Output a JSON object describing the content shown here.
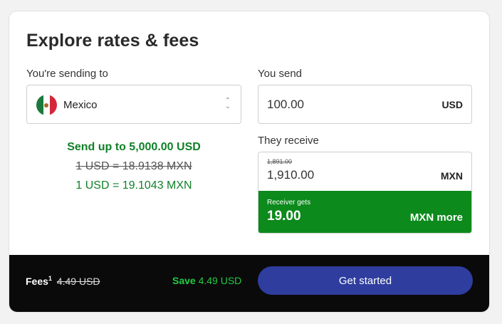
{
  "title": "Explore rates & fees",
  "country": {
    "label": "You're sending to",
    "selected": "Mexico",
    "flag_icon": "mexico-flag-icon"
  },
  "rates": {
    "limit": "Send up to 5,000.00 USD",
    "old_rate": "1 USD = 18.9138 MXN",
    "new_rate": "1 USD = 19.1043 MXN"
  },
  "send": {
    "label": "You send",
    "value": "100.00",
    "currency": "USD"
  },
  "receive": {
    "label": "They receive",
    "old_value": "1,891.00",
    "value": "1,910.00",
    "currency": "MXN",
    "banner_label": "Receiver gets",
    "banner_amount": "19.00",
    "banner_more": "MXN more"
  },
  "footer": {
    "fees_label": "Fees",
    "fees_sup": "1",
    "fees_old": "4.49 USD",
    "save_label": "Save",
    "save_amount": "4.49 USD",
    "cta_label": "Get started"
  },
  "colors": {
    "green": "#118028",
    "banner_green": "#0c8a1c",
    "cta_blue": "#2e3d9e",
    "footer_bg": "#0a0a0a",
    "save_green": "#22cc44"
  }
}
